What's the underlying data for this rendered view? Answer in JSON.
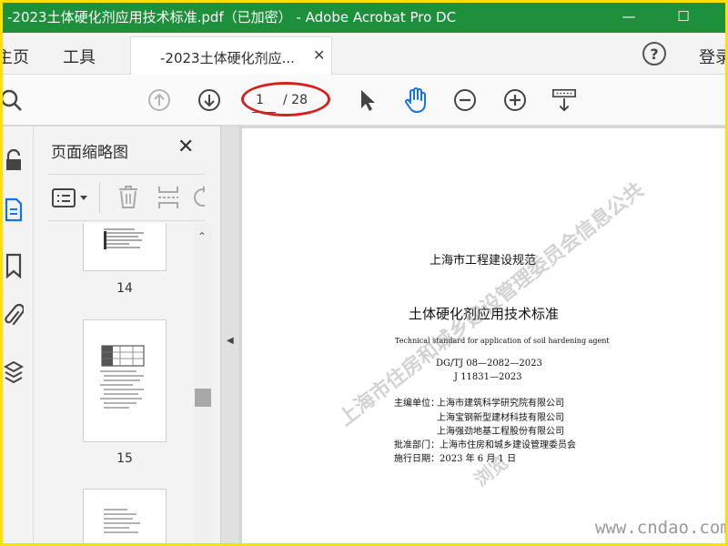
{
  "window": {
    "title": "-2023土体硬化剂应用技术标准.pdf（已加密） - Adobe Acrobat Pro DC",
    "minimize_glyph": "—",
    "maximize_glyph": "☐"
  },
  "tabs": {
    "home": "主页",
    "tools": "工具",
    "document_tab": "-2023土体硬化剂应...",
    "document_close": "✕",
    "help": "?",
    "sign_in": "登录"
  },
  "toolbar": {
    "current_page": "1",
    "total_pages": "/ 28"
  },
  "thumbnail_panel": {
    "title": "页面缩略图",
    "close": "✕",
    "pages": [
      {
        "number": "14"
      },
      {
        "number": "15"
      },
      {
        "number": ""
      }
    ]
  },
  "document": {
    "header": "上海市工程建设规范",
    "title": "土体硬化剂应用技术标准",
    "english_title": "Technical standard for application of soil hardening agent",
    "code_dg": "DG/TJ 08—2082—2023",
    "code_j": "J 11831—2023",
    "editor_label": "主编单位：",
    "editors": [
      "上海市建筑科学研究院有限公司",
      "上海宝钢新型建材科技有限公司",
      "上海强劲地基工程股份有限公司"
    ],
    "approval": "批准部门：上海市住房和城乡建设管理委员会",
    "effective": "施行日期：2023 年 6 月 1 日"
  },
  "watermarks": {
    "diagonal": "上海市住房和城乡建设管理委员会信息公共",
    "diagonal2": "浏览",
    "site": "www.cndao.com"
  },
  "colors": {
    "titlebar": "#1e8f3a",
    "accent_blue": "#1473e6",
    "annotation_red": "#d62020"
  }
}
